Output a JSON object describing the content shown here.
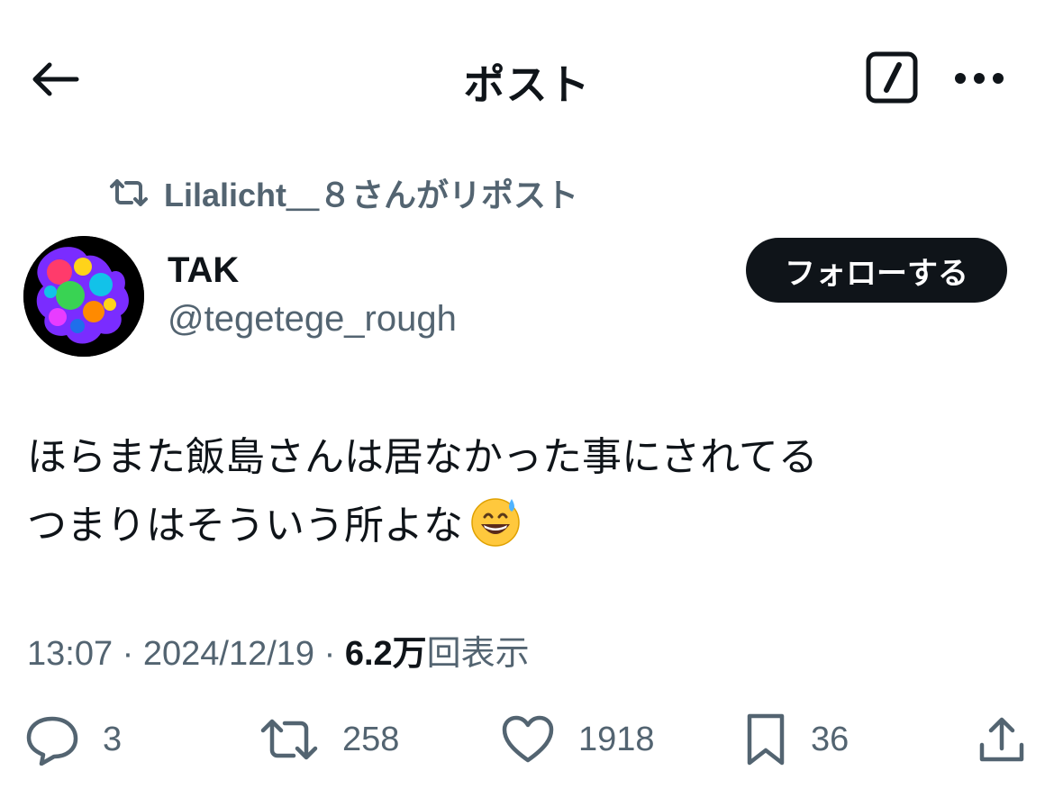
{
  "header": {
    "title": "ポスト",
    "back_icon": "arrow-left-icon",
    "edit_icon": "slash-square-icon",
    "more_icon": "more-horizontal-icon"
  },
  "repost": {
    "text": "Lilalicht＿８さんがリポスト",
    "icon": "repost-icon"
  },
  "author": {
    "name": "TAK",
    "handle": "@tegetege_rough"
  },
  "follow_button": "フォローする",
  "tweet": {
    "line1": "ほらまた飯島さんは居なかった事にされてる",
    "line2": "つまりはそういう所よな",
    "emoji": "grinning-face-with-sweat-emoji"
  },
  "meta": {
    "time": "13:07",
    "sep1": " · ",
    "date": "2024/12/19",
    "sep2": " · ",
    "views_count": "6.2万",
    "views_label": "回表示"
  },
  "actions": {
    "replies": {
      "icon": "reply-icon",
      "count": "3"
    },
    "reposts": {
      "icon": "repost-icon",
      "count": "258"
    },
    "likes": {
      "icon": "heart-icon",
      "count": "1918"
    },
    "bookmarks": {
      "icon": "bookmark-icon",
      "count": "36"
    },
    "share": {
      "icon": "share-icon"
    }
  },
  "colors": {
    "text": "#0f1419",
    "secondary": "#536471",
    "button_bg": "#0f1419",
    "button_text": "#ffffff"
  }
}
